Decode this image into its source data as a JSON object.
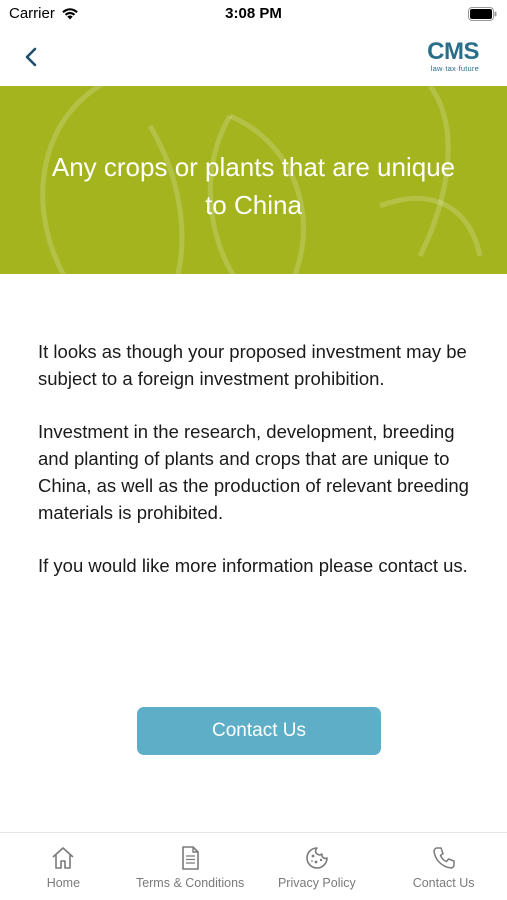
{
  "status_bar": {
    "carrier": "Carrier",
    "time": "3:08 PM"
  },
  "nav": {
    "logo_text": "CMS",
    "logo_tagline": "law·tax·future"
  },
  "hero": {
    "title": "Any crops or plants that are unique to China",
    "background_color": "#a4b41f"
  },
  "content": {
    "paragraphs": [
      "It looks as though your proposed investment may be subject to a foreign investment prohibition.",
      "Investment in the research, development, breeding and planting of plants and crops that are unique to China, as well as the production of relevant breeding materials is prohibited.",
      "If you would like more information please contact us."
    ]
  },
  "contact_button": {
    "label": "Contact Us",
    "color": "#5eaec8"
  },
  "tab_bar": {
    "tabs": [
      {
        "label": "Home",
        "icon": "home-icon"
      },
      {
        "label": "Terms & Conditions",
        "icon": "document-icon"
      },
      {
        "label": "Privacy Policy",
        "icon": "cookie-icon"
      },
      {
        "label": "Contact Us",
        "icon": "phone-icon"
      }
    ]
  }
}
